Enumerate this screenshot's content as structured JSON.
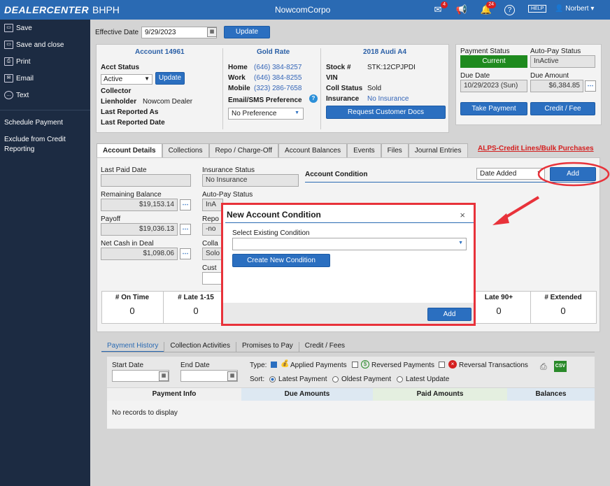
{
  "topbar": {
    "logo": "DEALERCENTER",
    "subapp": "BHPH",
    "company": "NowcomCorpo",
    "mail_badge": "4",
    "notif_badge": "24",
    "help": "HELP",
    "user": "Norbert ▾"
  },
  "sidebar": {
    "items": [
      {
        "label": "Save",
        "icon": "save-icon"
      },
      {
        "label": "Save and close",
        "icon": "save-close-icon"
      },
      {
        "label": "Print",
        "icon": "print-icon"
      },
      {
        "label": "Email",
        "icon": "email-icon"
      },
      {
        "label": "Text",
        "icon": "sms-icon"
      }
    ],
    "links": [
      "Schedule Payment",
      "Exclude from Credit Reporting"
    ]
  },
  "effective": {
    "label": "Effective Date",
    "value": "9/29/2023",
    "update": "Update"
  },
  "account": {
    "title": "Account 14961",
    "acct_status_label": "Acct Status",
    "acct_status_value": "Active",
    "update": "Update",
    "collector": "Collector",
    "lienholder_label": "Lienholder",
    "lienholder_value": "Nowcom Dealer",
    "last_reported_as": "Last Reported As",
    "last_reported_date": "Last Reported Date"
  },
  "contact": {
    "title": "Gold Rate",
    "home_label": "Home",
    "home": "(646) 384-8257",
    "work_label": "Work",
    "work": "(646) 384-8255",
    "mobile_label": "Mobile",
    "mobile": "(323) 286-7658",
    "email_pref_label": "Email/SMS Preference",
    "email_pref_value": "No Preference"
  },
  "vehicle": {
    "title": "2018 Audi A4",
    "stock_label": "Stock #",
    "stock": "STK:12CPJPDI",
    "vin_label": "VIN",
    "coll_status_label": "Coll Status",
    "coll_status": "Sold",
    "insurance_label": "Insurance",
    "insurance": "No Insurance",
    "request_docs": "Request Customer Docs"
  },
  "payment": {
    "status_label": "Payment Status",
    "status": "Current",
    "autopay_label": "Auto-Pay Status",
    "autopay": "InActive",
    "due_date_label": "Due Date",
    "due_date": "10/29/2023 (Sun)",
    "due_amount_label": "Due Amount",
    "due_amount": "$6,384.85",
    "take_payment": "Take Payment",
    "credit_fee": "Credit / Fee",
    "status_color": "#1e8a1e"
  },
  "tabs": [
    "Account Details",
    "Collections",
    "Repo / Charge-Off",
    "Account Balances",
    "Events",
    "Files",
    "Journal Entries"
  ],
  "alps_link": "ALPS-Credit Lines/Bulk Purchases",
  "details": {
    "last_paid_label": "Last Paid Date",
    "remaining_label": "Remaining Balance",
    "remaining": "$19,153.14",
    "payoff_label": "Payoff",
    "payoff": "$19,036.13",
    "net_cash_label": "Net Cash in Deal",
    "net_cash": "$1,098.06",
    "insurance_status_label": "Insurance Status",
    "insurance_status": "No Insurance",
    "autopay_status_label": "Auto-Pay Status",
    "autopay_status": "InA",
    "repo_label": "Repo",
    "repo_value": "-no",
    "coll_label": "Colla",
    "coll_value": "Solo",
    "cust_label": "Cust"
  },
  "condition": {
    "title": "Account Condition",
    "sort": "Date Added",
    "add": "Add"
  },
  "stats": [
    {
      "label": "# On Time",
      "value": "0"
    },
    {
      "label": "# Late 1-15",
      "value": "0"
    },
    {
      "label": "Late 90+",
      "value": "0"
    },
    {
      "label": "# Extended",
      "value": "0"
    }
  ],
  "history_tabs": [
    "Payment History",
    "Collection Activities",
    "Promises to Pay",
    "Credit / Fees"
  ],
  "history": {
    "start_label": "Start Date",
    "end_label": "End Date",
    "type_label": "Type:",
    "applied": "Applied Payments",
    "reversed": "Reversed Payments",
    "reversal_tx": "Reversal Transactions",
    "sort_label": "Sort:",
    "latest": "Latest Payment",
    "oldest": "Oldest Payment",
    "latest_update": "Latest Update",
    "col_info": "Payment Info",
    "col_due": "Due Amounts",
    "col_paid": "Paid Amounts",
    "col_bal": "Balances",
    "empty": "No records to display"
  },
  "modal": {
    "title": "New Account Condition",
    "close": "×",
    "select_label": "Select Existing Condition",
    "create": "Create New Condition",
    "add": "Add"
  }
}
